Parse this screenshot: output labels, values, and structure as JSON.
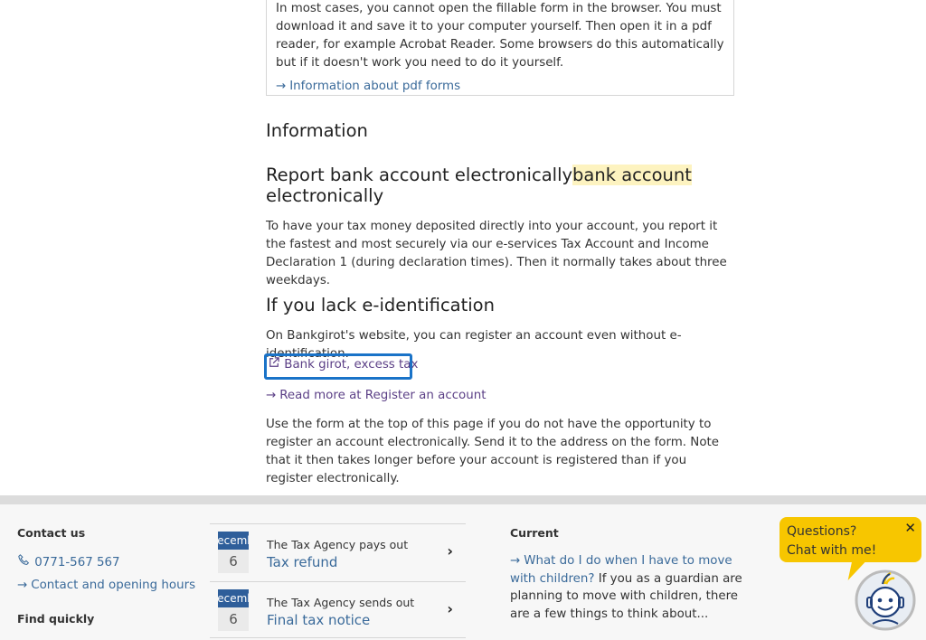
{
  "pdf_info": {
    "text": "In most cases, you cannot open the fillable form in the browser. You must download it and save it to your computer yourself. Then open it in a pdf reader, for example Acrobat Reader. Some browsers do this automatically but if it doesn't work you need to do it yourself.",
    "link": "Information about pdf forms"
  },
  "info_heading": "Information",
  "report": {
    "heading": "Report bank account electronically",
    "heading_highlight": "bank account",
    "heading_rest": "electronically",
    "text": "To have your tax money deposited directly into your account, you report it the fastest and most securely via our e-services Tax Account and Income Declaration 1 (during declaration times). Then it normally takes about three weekdays."
  },
  "lack": {
    "heading": "If you lack e-identification",
    "text": "On Bankgirot's website, you can register an account even without e-identification.",
    "external_link": "Bank girot, excess tax",
    "read_more_link": "Read more at Register an account",
    "text2": "Use the form at the top of this page if you do not have the opportunity to register an account electronically. Send it to the address on the form. Note that it then takes longer before your account is registered than if you register electronically."
  },
  "footer": {
    "contact_title": "Contact us",
    "phone": "0771-567 567",
    "contact_link": "Contact and opening hours",
    "find_title": "Find quickly",
    "calendar": [
      {
        "month": "December",
        "day": "6",
        "subtitle": "The Tax Agency pays out",
        "title": "Tax refund"
      },
      {
        "month": "December",
        "day": "6",
        "subtitle": "The Tax Agency sends out",
        "title": "Final tax notice"
      }
    ],
    "current_title": "Current",
    "current_link": "What do I do when I have to move with children?",
    "current_text": " If you as a guardian are planning to move with children, there are a few things to think about..."
  },
  "chat": {
    "line1": "Questions?",
    "line2": "Chat with me!"
  },
  "colors": {
    "link": "#3a6a9a",
    "visited": "#5b3f86",
    "chat": "#f7c600",
    "focus": "#1a73c8",
    "highlight": "#fdf3c0"
  }
}
